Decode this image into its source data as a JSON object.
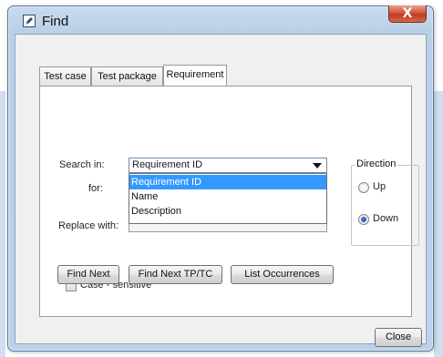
{
  "window": {
    "title": "Find",
    "close_glyph": "X"
  },
  "tabs": [
    {
      "label": "Test case"
    },
    {
      "label": "Test package"
    },
    {
      "label": "Requirement",
      "active": true
    }
  ],
  "form": {
    "search_in_label": "Search in:",
    "search_in_value": "Requirement ID",
    "for_label": "for:",
    "replace_with_label": "Replace with:",
    "dropdown_options": [
      "Requirement ID",
      "Name",
      "Description"
    ],
    "selected_option": "Requirement ID",
    "case_sensitive_label": "Case - sensitive",
    "case_sensitive_checked": false
  },
  "direction": {
    "title": "Direction",
    "options": [
      {
        "label": "Up",
        "checked": false
      },
      {
        "label": "Down",
        "checked": true
      }
    ]
  },
  "buttons": {
    "find_next": "Find Next",
    "find_next_tptc": "Find Next TP/TC",
    "list_occurrences": "List Occurrences",
    "close": "Close"
  },
  "icons": {
    "title_icon": "edit-find-icon",
    "close": "close-icon",
    "combo_arrow": "chevron-down-icon"
  },
  "colors": {
    "selection": "#3399ff",
    "close_button": "#c23b1f",
    "title_bar": "#c9dbee"
  }
}
